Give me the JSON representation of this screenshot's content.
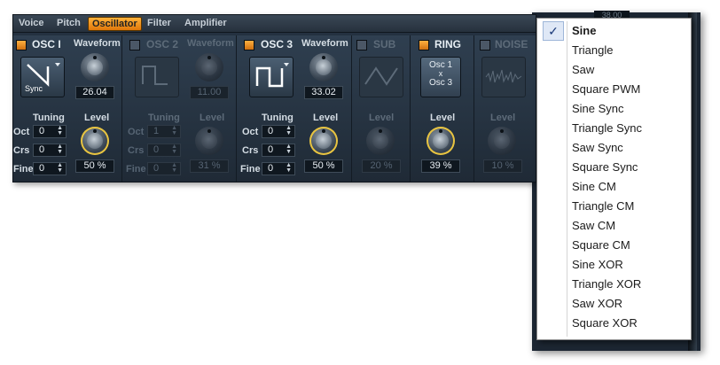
{
  "menubar": [
    "Voice",
    "Pitch",
    "Oscillator",
    "Filter",
    "Amplifier"
  ],
  "active_menu": "Oscillator",
  "osc1": {
    "title": "OSC I",
    "waveform_label": "Waveform",
    "wave_value": "26.04",
    "sync_label": "Sync",
    "tuning_label": "Tuning",
    "level_label": "Level",
    "oct": "0",
    "crs": "0",
    "fine": "0",
    "level": "50 %"
  },
  "osc2": {
    "title": "OSC 2",
    "waveform_label": "Waveform",
    "wave_value": "11.00",
    "tuning_label": "Tuning",
    "level_label": "Level",
    "oct": "1",
    "crs": "0",
    "fine": "0",
    "level": "31 %"
  },
  "osc3": {
    "title": "OSC 3",
    "waveform_label": "Waveform",
    "wave_value": "33.02",
    "tuning_label": "Tuning",
    "level_label": "Level",
    "oct": "0",
    "crs": "0",
    "fine": "0",
    "level": "50 %"
  },
  "sub": {
    "title": "SUB",
    "level_label": "Level",
    "level": "20 %"
  },
  "ring": {
    "title": "RING",
    "sel_top": "Osc 1",
    "sel_mid": "x",
    "sel_bot": "Osc 3",
    "level_label": "Level",
    "level": "39 %"
  },
  "noise": {
    "title": "NOISE",
    "level_label": "Level",
    "level": "10 %"
  },
  "row_labels": {
    "oct": "Oct",
    "crs": "Crs",
    "fine": "Fine"
  },
  "bg_field": "38.00",
  "dropdown": {
    "selected": "Sine",
    "check": "✓",
    "items": [
      "Sine",
      "Triangle",
      "Saw",
      "Square PWM",
      "Sine Sync",
      "Triangle Sync",
      "Saw Sync",
      "Square Sync",
      "Sine CM",
      "Triangle CM",
      "Saw CM",
      "Square CM",
      "Sine XOR",
      "Triangle XOR",
      "Saw XOR",
      "Square XOR"
    ]
  }
}
